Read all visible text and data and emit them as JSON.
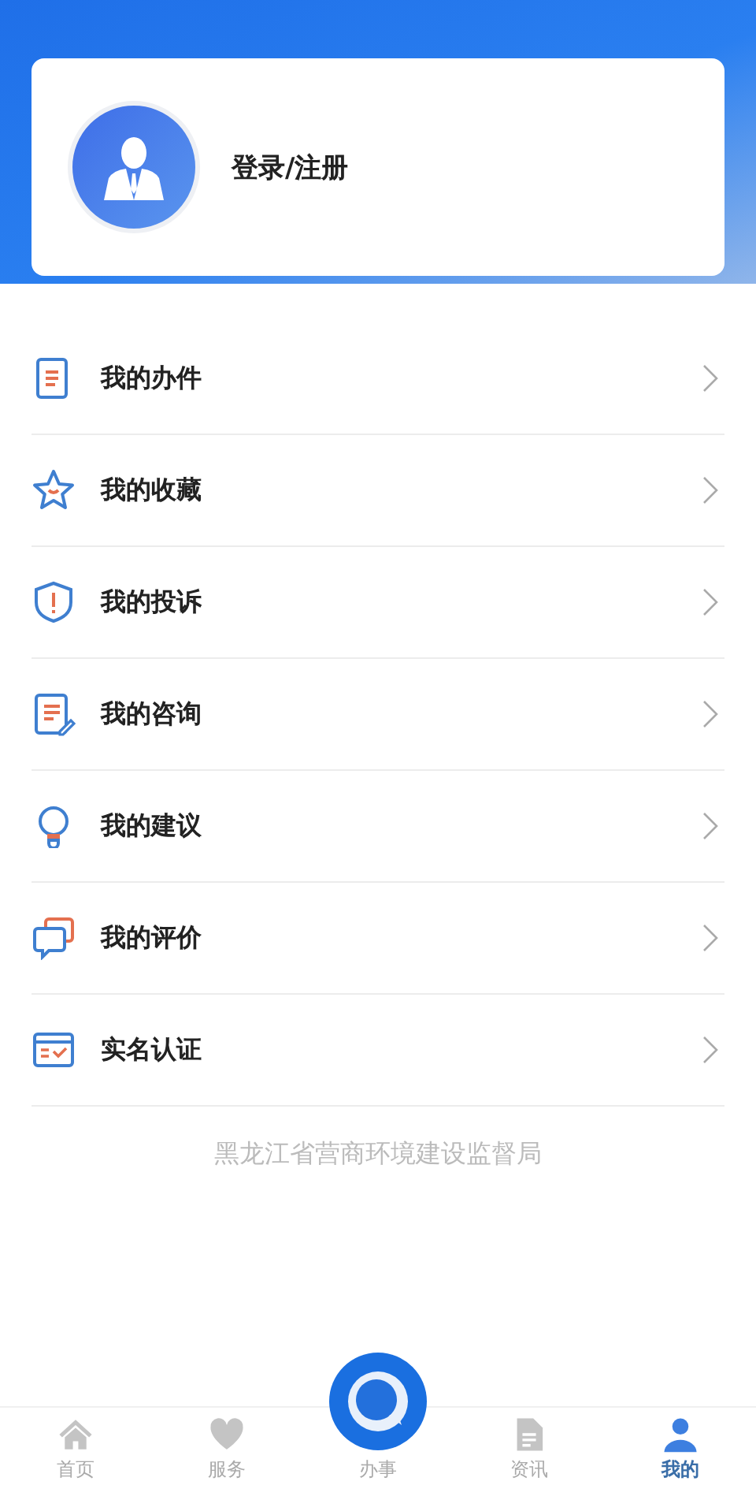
{
  "profile": {
    "login_label": "登录/注册"
  },
  "menu": [
    {
      "label": "我的办件",
      "kind": "document"
    },
    {
      "label": "我的收藏",
      "kind": "star"
    },
    {
      "label": "我的投诉",
      "kind": "shield"
    },
    {
      "label": "我的咨询",
      "kind": "edit"
    },
    {
      "label": "我的建议",
      "kind": "bulb"
    },
    {
      "label": "我的评价",
      "kind": "chat"
    },
    {
      "label": "实名认证",
      "kind": "card"
    }
  ],
  "footer": "黑龙江省营商环境建设监督局",
  "tabs": [
    {
      "label": "首页",
      "kind": "home",
      "selected": false
    },
    {
      "label": "服务",
      "kind": "heart",
      "selected": false
    },
    {
      "label": "办事",
      "kind": "center",
      "selected": false
    },
    {
      "label": "资讯",
      "kind": "file",
      "selected": false
    },
    {
      "label": "我的",
      "kind": "person",
      "selected": true
    }
  ]
}
